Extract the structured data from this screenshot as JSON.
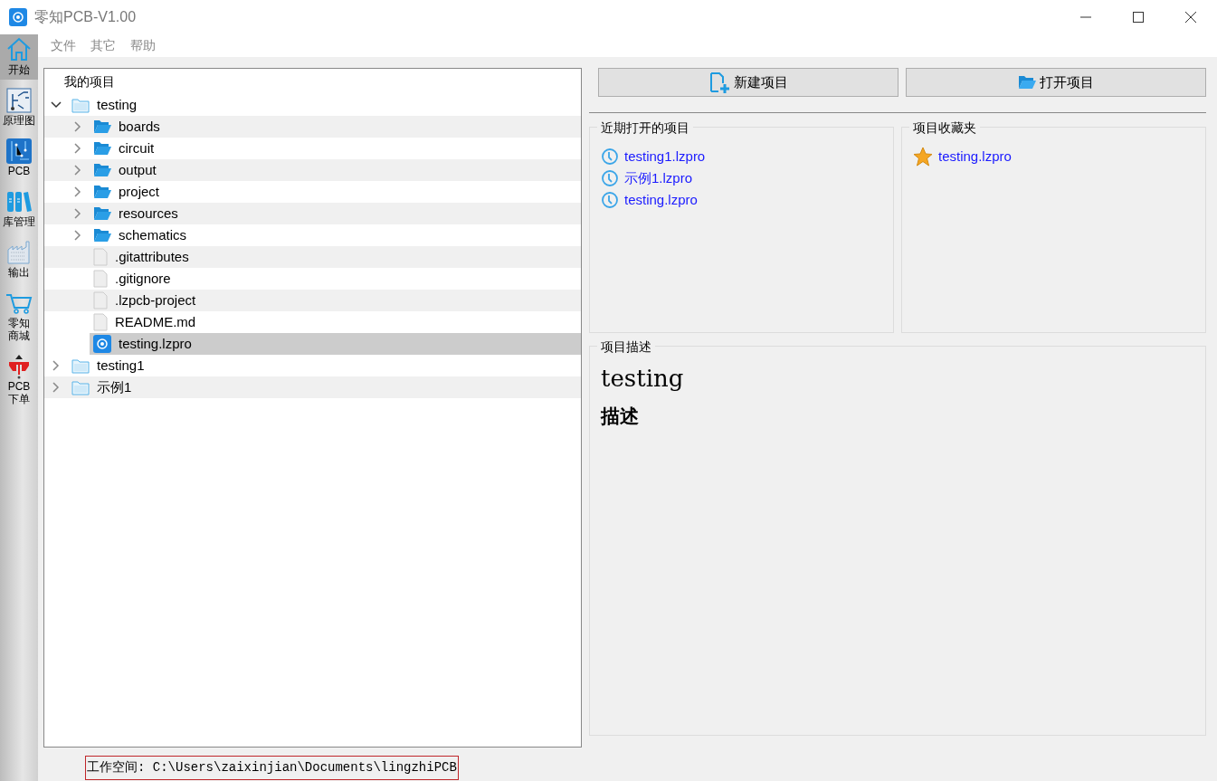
{
  "window": {
    "title": "零知PCB-V1.00"
  },
  "menu": [
    "文件",
    "其它",
    "帮助"
  ],
  "sidebar": [
    {
      "kind": "home",
      "lines": [
        "开始"
      ],
      "selected": true
    },
    {
      "kind": "schematic",
      "lines": [
        "原理图"
      ],
      "selected": false
    },
    {
      "kind": "pcb",
      "lines": [
        "PCB"
      ],
      "selected": false
    },
    {
      "kind": "library",
      "lines": [
        "库管理"
      ],
      "selected": false
    },
    {
      "kind": "output",
      "lines": [
        "输出"
      ],
      "selected": false
    },
    {
      "kind": "shop",
      "lines": [
        "零知",
        "商城"
      ],
      "selected": false
    },
    {
      "kind": "order",
      "lines": [
        "PCB",
        "下单"
      ],
      "selected": false
    }
  ],
  "tree": {
    "title": "我的项目",
    "items": [
      {
        "kind": "project",
        "label": "testing",
        "expanded": true,
        "selected": false,
        "children": [
          {
            "kind": "folder",
            "label": "boards",
            "expanded": false,
            "selected": false
          },
          {
            "kind": "folder",
            "label": "circuit",
            "expanded": false,
            "selected": false
          },
          {
            "kind": "folder",
            "label": "output",
            "expanded": false,
            "selected": false
          },
          {
            "kind": "folder",
            "label": "project",
            "expanded": false,
            "selected": false
          },
          {
            "kind": "folder",
            "label": "resources",
            "expanded": false,
            "selected": false
          },
          {
            "kind": "folder",
            "label": "schematics",
            "expanded": false,
            "selected": false
          },
          {
            "kind": "file",
            "label": ".gitattributes",
            "selected": false
          },
          {
            "kind": "file",
            "label": ".gitignore",
            "selected": false
          },
          {
            "kind": "file",
            "label": ".lzpcb-project",
            "selected": false
          },
          {
            "kind": "file",
            "label": "README.md",
            "selected": false
          },
          {
            "kind": "lzpro",
            "label": "testing.lzpro",
            "selected": true
          }
        ]
      },
      {
        "kind": "project",
        "label": "testing1",
        "expanded": false,
        "selected": false
      },
      {
        "kind": "project",
        "label": "示例1",
        "expanded": false,
        "selected": false
      }
    ]
  },
  "buttons": [
    {
      "kind": "new",
      "label": "新建项目"
    },
    {
      "kind": "open",
      "label": "打开项目"
    }
  ],
  "recent": {
    "title": "近期打开的项目",
    "items": [
      "testing1.lzpro",
      "示例1.lzpro",
      "testing.lzpro"
    ]
  },
  "favorites": {
    "title": "项目收藏夹",
    "items": [
      "testing.lzpro"
    ]
  },
  "description": {
    "title": "项目描述",
    "name": "testing",
    "text": "描述"
  },
  "status_bar": "工作空间: C:\\Users\\zaixinjian\\Documents\\lingzhiPCB"
}
